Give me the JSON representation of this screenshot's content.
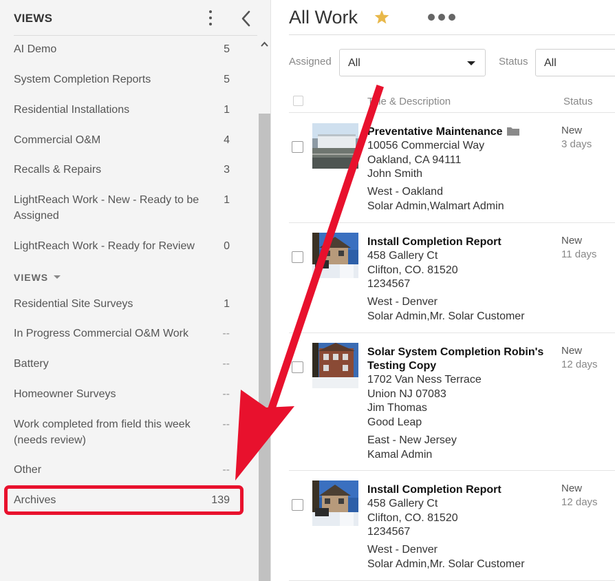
{
  "sidebar": {
    "title": "VIEWS",
    "items": [
      {
        "label": "AI Demo",
        "count": "5"
      },
      {
        "label": "System Completion Reports",
        "count": "5"
      },
      {
        "label": "Residential Installations",
        "count": "1"
      },
      {
        "label": "Commercial O&M",
        "count": "4"
      },
      {
        "label": "Recalls & Repairs",
        "count": "3"
      },
      {
        "label": "LightReach Work - New - Ready to be Assigned",
        "count": "1"
      },
      {
        "label": "LightReach Work - Ready for Review",
        "count": "0"
      }
    ],
    "section2_title": "VIEWS",
    "items2": [
      {
        "label": "Residential Site Surveys",
        "count": "1"
      },
      {
        "label": "In Progress Commercial O&M Work",
        "count": "--"
      },
      {
        "label": "Battery",
        "count": "--"
      },
      {
        "label": "Homeowner Surveys",
        "count": "--"
      },
      {
        "label": "Work completed from field this week (needs review)",
        "count": "--"
      },
      {
        "label": "Other",
        "count": "--"
      },
      {
        "label": "Archives",
        "count": "139"
      }
    ]
  },
  "main": {
    "title": "All Work",
    "filters": {
      "assigned_label": "Assigned",
      "assigned_value": "All",
      "status_label": "Status",
      "status_value": "All"
    },
    "columns": {
      "title": "Title & Description",
      "status": "Status"
    },
    "rows": [
      {
        "title": "Preventative Maintenance",
        "lines": [
          "10056 Commercial Way",
          "Oakland, CA 94111",
          "John Smith"
        ],
        "lines2": [
          "West - Oakland",
          "Solar Admin,Walmart Admin"
        ],
        "status": "New",
        "age": "3 days"
      },
      {
        "title": "Install Completion Report",
        "lines": [
          "458 Gallery Ct",
          "Clifton, CO. 81520",
          "1234567"
        ],
        "lines2": [
          "West - Denver",
          "Solar Admin,Mr. Solar Customer"
        ],
        "status": "New",
        "age": "11 days"
      },
      {
        "title": "Solar System Completion Robin's Testing Copy",
        "lines": [
          "1702 Van Ness Terrace",
          "Union NJ 07083",
          "Jim Thomas",
          "Good Leap"
        ],
        "lines2": [
          "East - New Jersey",
          "Kamal Admin"
        ],
        "status": "New",
        "age": "12 days"
      },
      {
        "title": "Install Completion Report",
        "lines": [
          "458 Gallery Ct",
          "Clifton, CO. 81520",
          "1234567"
        ],
        "lines2": [
          "West - Denver",
          "Solar Admin,Mr. Solar Customer"
        ],
        "status": "New",
        "age": "12 days"
      }
    ]
  },
  "colors": {
    "highlight": "#e8112d",
    "star": "#e8b84a",
    "sidebar_bg": "#f4f4f4"
  }
}
